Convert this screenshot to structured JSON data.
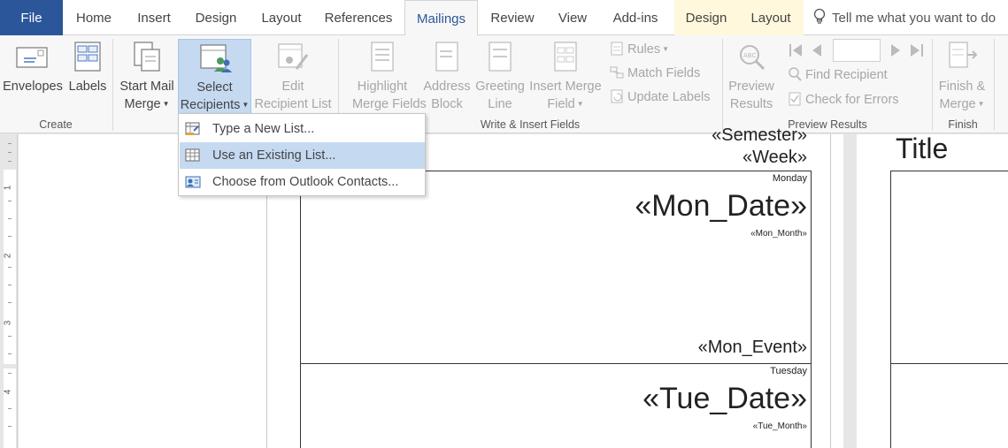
{
  "tabs": [
    {
      "label": "File"
    },
    {
      "label": "Home"
    },
    {
      "label": "Insert"
    },
    {
      "label": "Design"
    },
    {
      "label": "Layout"
    },
    {
      "label": "References"
    },
    {
      "label": "Mailings"
    },
    {
      "label": "Review"
    },
    {
      "label": "View"
    },
    {
      "label": "Add-ins"
    },
    {
      "label": "Design"
    },
    {
      "label": "Layout"
    }
  ],
  "tellme": {
    "text": "Tell me what you want to do"
  },
  "ribbon": {
    "create": {
      "label": "Create",
      "envelopes": "Envelopes",
      "labels": "Labels"
    },
    "start": {
      "start_l1": "Start Mail",
      "start_l2": "Merge",
      "select_l1": "Select",
      "select_l2": "Recipients",
      "edit_l1": "Edit",
      "edit_l2": "Recipient List"
    },
    "write": {
      "label": "Write & Insert Fields",
      "highlight_l1": "Highlight",
      "highlight_l2": "Merge Fields",
      "address_l1": "Address",
      "address_l2": "Block",
      "greeting_l1": "Greeting",
      "greeting_l2": "Line",
      "insert_l1": "Insert Merge",
      "insert_l2": "Field",
      "rules": "Rules",
      "match": "Match Fields",
      "update": "Update Labels"
    },
    "preview": {
      "label": "Preview Results",
      "preview_l1": "Preview",
      "preview_l2": "Results",
      "find": "Find Recipient",
      "check": "Check for Errors"
    },
    "finish": {
      "label": "Finish",
      "finish_l1": "Finish &",
      "finish_l2": "Merge"
    }
  },
  "dropdown": {
    "items": [
      {
        "label": "Type a New List..."
      },
      {
        "label": "Use an Existing List..."
      },
      {
        "label": "Choose from Outlook Contacts..."
      }
    ]
  },
  "document": {
    "semester": "«Semester»",
    "week": "«Week»",
    "days": [
      {
        "name": "Monday",
        "date": "«Mon_Date»",
        "month": "«Mon_Month»",
        "event": "«Mon_Event»"
      },
      {
        "name": "Tuesday",
        "date": "«Tue_Date»",
        "month": "«Tue_Month»"
      }
    ],
    "title": "Title"
  },
  "ruler": {
    "marks": [
      "1",
      "2",
      "3",
      "4"
    ]
  },
  "colors": {
    "accent": "#2b579a",
    "pressed": "#c5d9f1",
    "context_tab": "#fff8dc"
  }
}
